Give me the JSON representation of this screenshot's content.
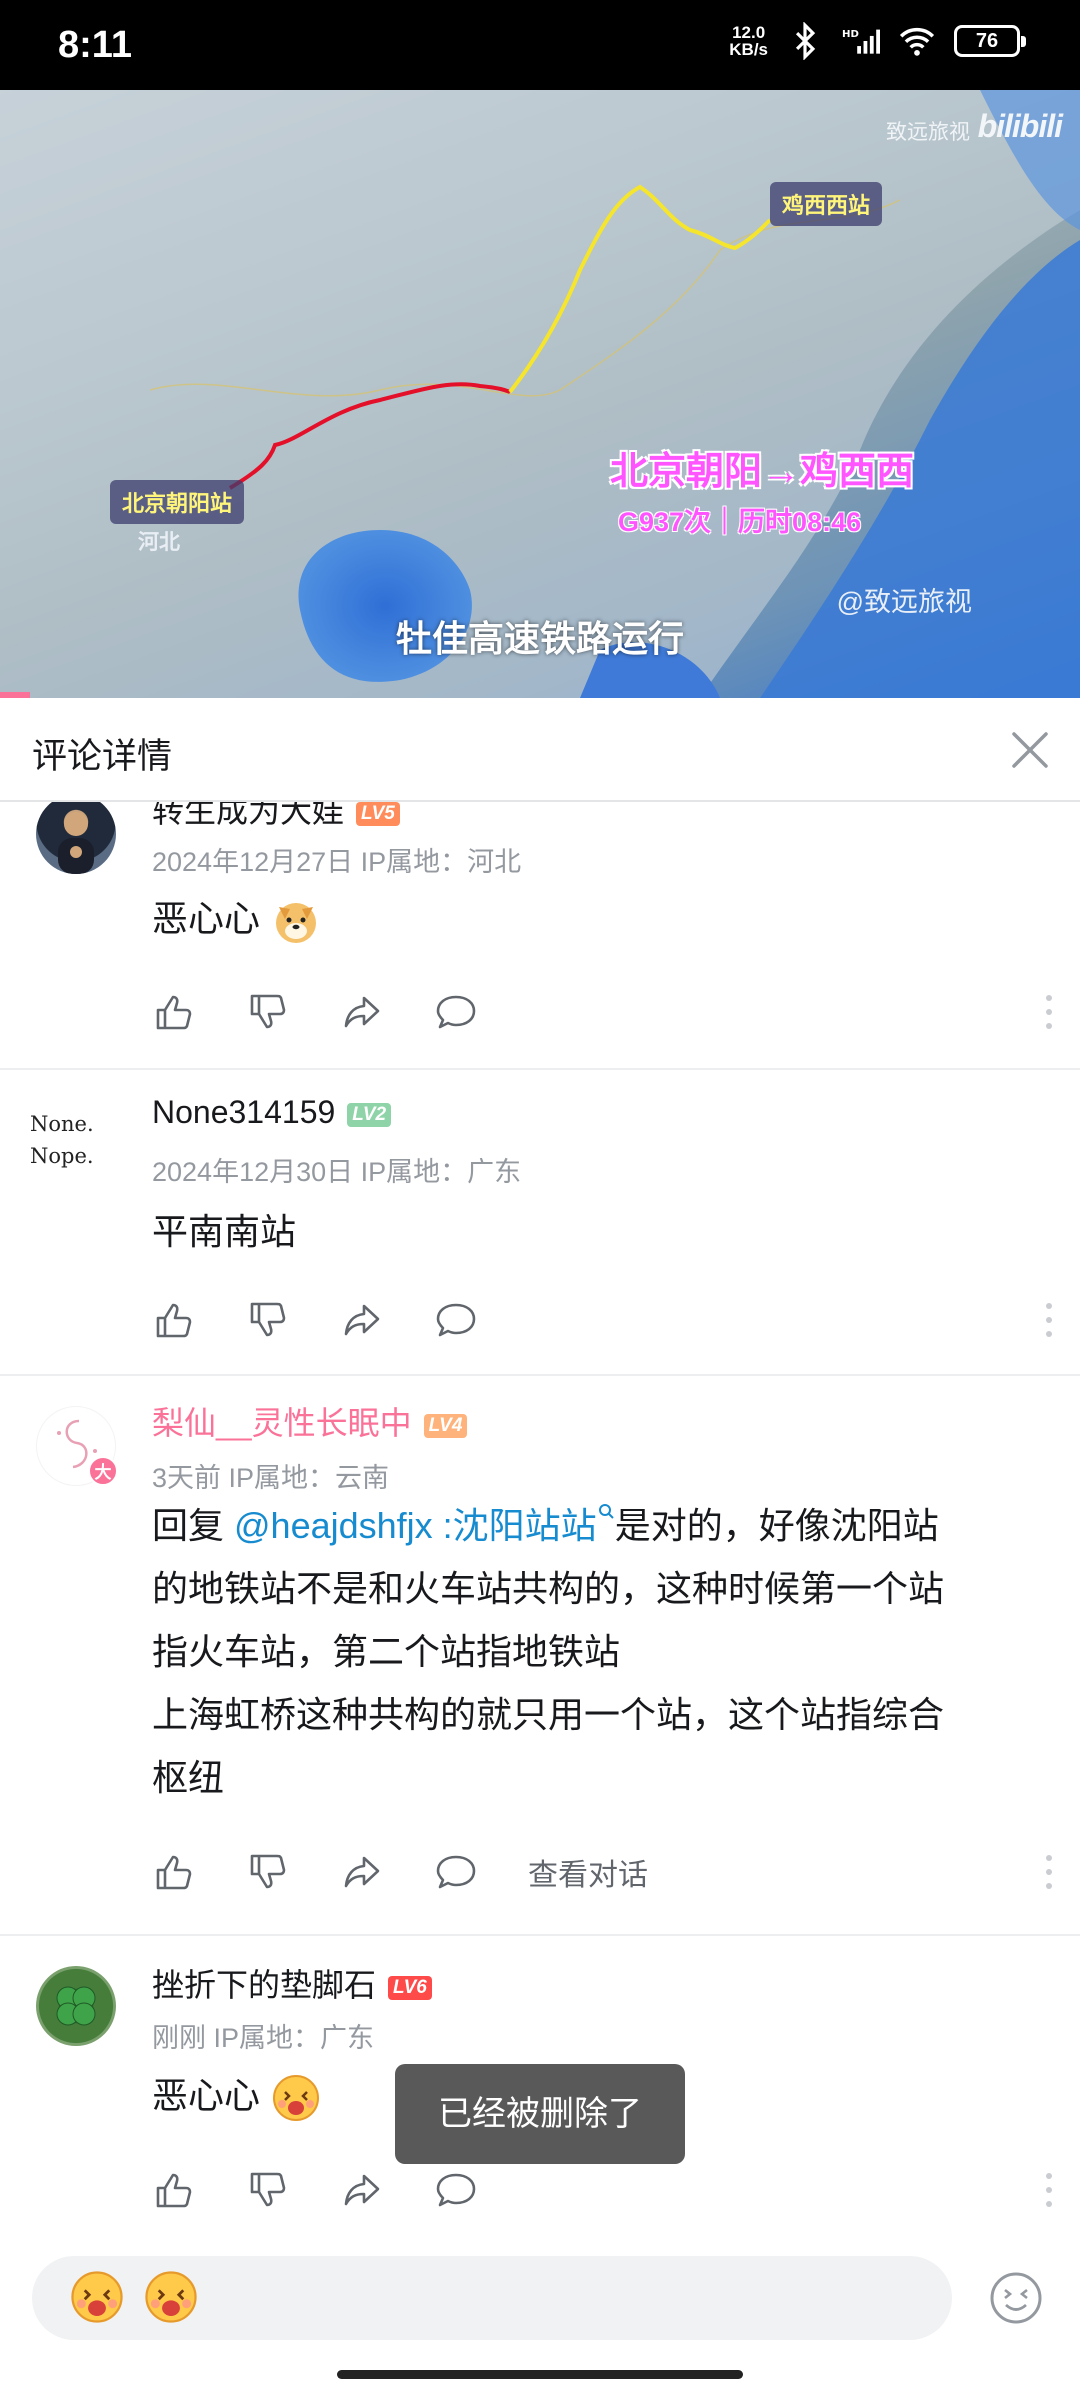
{
  "status": {
    "time": "8:11",
    "net_speed_value": "12.0",
    "net_speed_unit": "KB/s",
    "battery": "76"
  },
  "video": {
    "watermark_text": "致远旅视",
    "watermark_logo": "bilibili",
    "end_station": "鸡西西站",
    "start_station": "北京朝阳站",
    "province": "河北",
    "route_title": "北京朝阳→鸡西西",
    "route_sub": "G937次｜历时08:46",
    "author_mark": "@致远旅视",
    "subtitle": "牡佳高速铁路运行"
  },
  "header": {
    "title": "评论详情",
    "close_icon": "close-icon"
  },
  "comments": [
    {
      "username": "转生成为大娃",
      "level": "LV5",
      "level_color": "#ff6699",
      "meta": "2024年12月27日 IP属地：河北",
      "text": "恶心心",
      "emoji": "doge-emoji"
    },
    {
      "username": "None314159",
      "level": "LV2",
      "level_color": "#95ddb2",
      "avatar_line1": "None.",
      "avatar_line2": "Nope.",
      "meta": "2024年12月30日 IP属地：广东",
      "text": "平南南站"
    },
    {
      "username": "梨仙__灵性长眠中",
      "username_color": "#fb7299",
      "level": "LV4",
      "level_color": "#ffb37c",
      "meta": "3天前 IP属地：云南",
      "reply_prefix": "回复 ",
      "mention": "@heajdshfjx",
      "quote": " :沈阳站站",
      "line1_rest": "是对的，好像沈阳站",
      "line2": "的地铁站不是和火车站共构的，这种时候第一个站",
      "line3": "指火车站，第二个站指地铁站",
      "line4": "上海虹桥这种共构的就只用一个站，这个站指综合",
      "line5": "枢纽",
      "view_conversation": "查看对话"
    },
    {
      "username": "挫折下的垫脚石",
      "level": "LV6",
      "level_color": "#ff4a4a",
      "meta": "刚刚 IP属地：广东",
      "text": "恶心心",
      "emoji": "smiling-emoji"
    }
  ],
  "toast": "已经被删除了",
  "input": {
    "emoji_icon": "emoji-button-icon"
  },
  "colors": {
    "accent": "#fb7299",
    "mention": "#178bcf",
    "meta_gray": "#9499a0"
  }
}
